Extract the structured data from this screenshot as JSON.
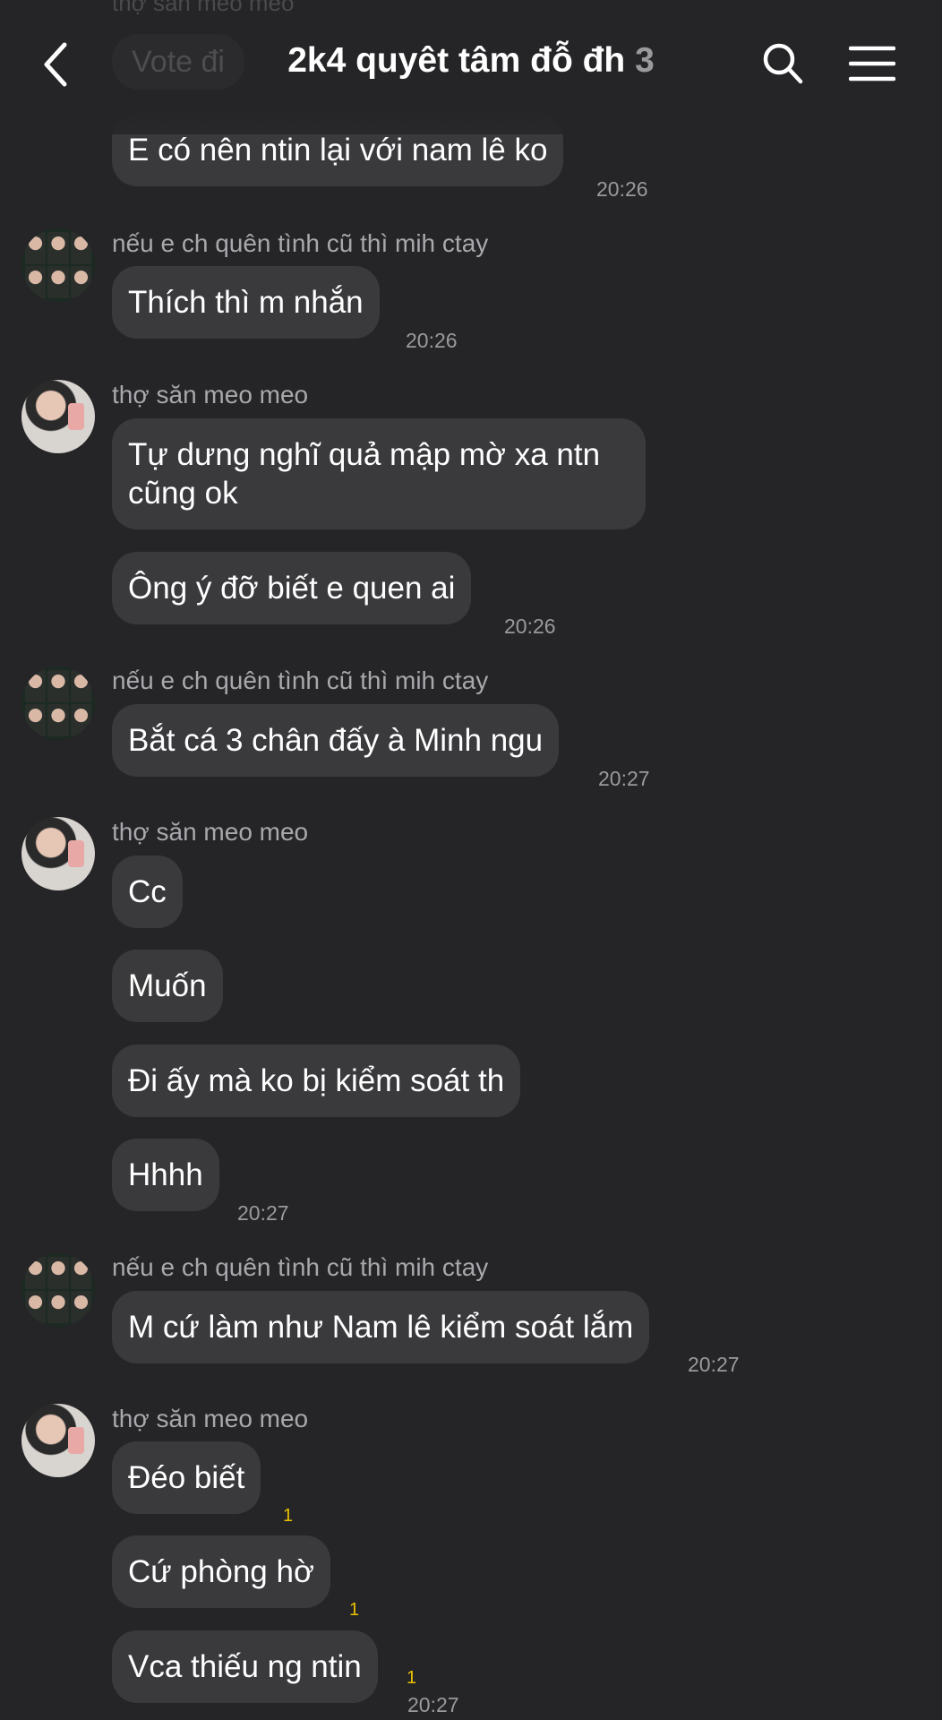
{
  "header": {
    "ghost_sender": "thợ săn meo meo",
    "ghost_message": "Vote đi",
    "title": "2k4 quyêt tâm đỗ đh",
    "member_count": "3",
    "back_icon": "chevron-left-icon",
    "search_icon": "search-icon",
    "menu_icon": "hamburger-menu-icon"
  },
  "colors": {
    "background": "#252527",
    "bubble": "#3a3a3d",
    "sender_text": "#a8a8ad",
    "timestamp": "#9a9a9e",
    "read_count": "#e8c100"
  },
  "messages": [
    {
      "text": "E có nên ntin lại với nam lê ko",
      "time": "20:26"
    },
    {
      "sender": "nếu e ch quên tình cũ thì mih ctay",
      "text": "Thích thì m nhắn",
      "time": "20:26"
    },
    {
      "sender": "thợ săn meo meo",
      "text": "Tự dưng nghĩ quả mập mờ xa ntn cũng ok"
    },
    {
      "text": "Ông ý đỡ biết e quen ai",
      "time": "20:26"
    },
    {
      "sender": "nếu e ch quên tình cũ thì mih ctay",
      "text": "Bắt cá 3 chân đấy à Minh ngu",
      "time": "20:27"
    },
    {
      "sender": "thợ săn meo meo",
      "text": "Cc"
    },
    {
      "text": "Muốn"
    },
    {
      "text": "Đi ấy mà ko bị kiểm soát th"
    },
    {
      "text": "Hhhh",
      "time": "20:27"
    },
    {
      "sender": "nếu e ch quên tình cũ thì mih ctay",
      "text": "M cứ làm như Nam lê kiểm soát lắm",
      "time": "20:27"
    },
    {
      "sender": "thợ săn meo meo",
      "text": "Đéo biết",
      "unread": "1"
    },
    {
      "text": "Cứ phòng hờ",
      "unread": "1"
    },
    {
      "text": "Vca thiếu ng ntin",
      "unread": "1",
      "time": "20:27"
    }
  ]
}
